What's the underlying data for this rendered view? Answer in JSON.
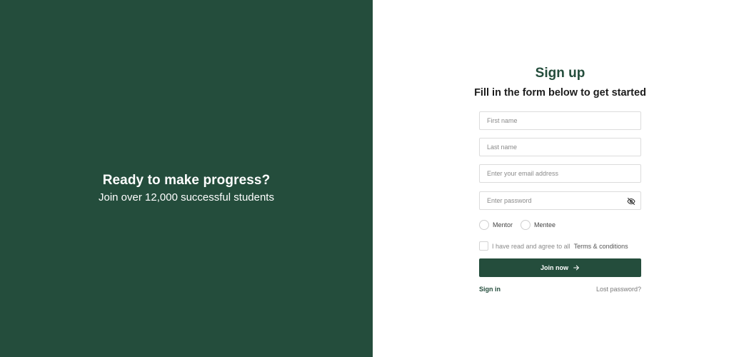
{
  "hero": {
    "title": "Ready to make progress?",
    "subtitle": "Join over 12,000 successful students"
  },
  "form": {
    "heading": "Sign up",
    "subheading": "Fill in the form below to get started",
    "first_name": {
      "placeholder": "First name",
      "value": ""
    },
    "last_name": {
      "placeholder": "Last name",
      "value": ""
    },
    "email": {
      "placeholder": "Enter your email address",
      "value": ""
    },
    "password": {
      "placeholder": "Enter password",
      "value": "",
      "toggle_icon": "eye-off-icon"
    },
    "roles": [
      {
        "label": "Mentor",
        "selected": false
      },
      {
        "label": "Mentee",
        "selected": false
      }
    ],
    "terms": {
      "text": "I have read and agree to all",
      "link": "Terms & conditions",
      "checked": false
    },
    "submit_label": "Join now",
    "submit_icon": "arrow-right-icon",
    "signin_label": "Sign in",
    "lost_password_label": "Lost password?"
  },
  "colors": {
    "brand": "#244d3c",
    "background": "#ffffff",
    "field_border": "#dcdcdc"
  }
}
